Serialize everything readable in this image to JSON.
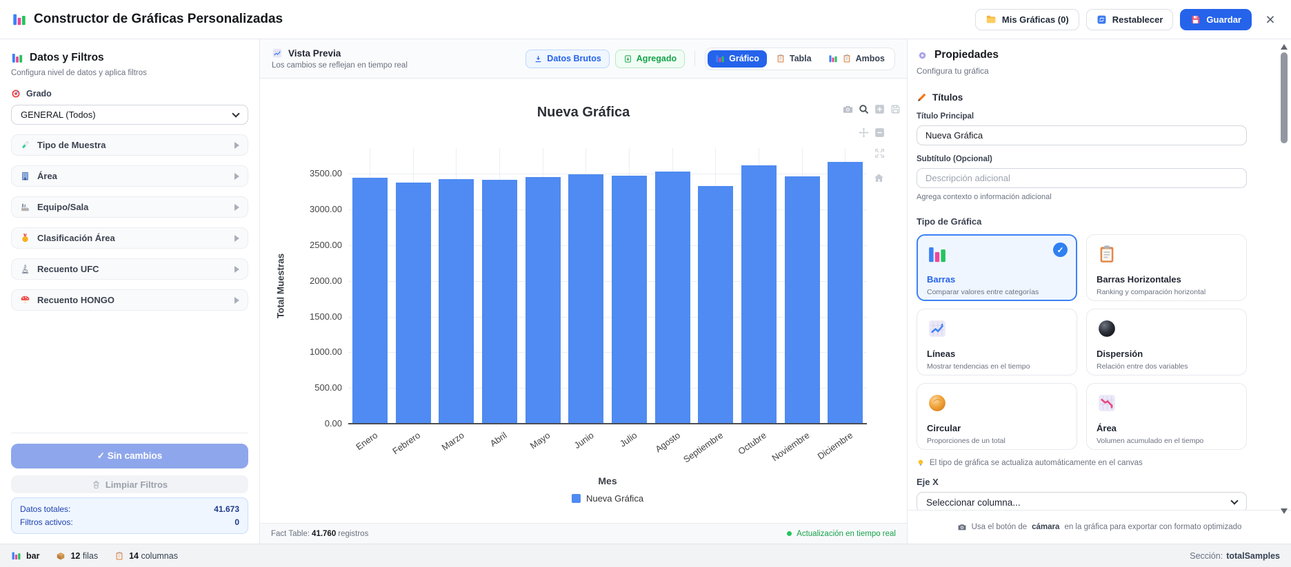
{
  "header": {
    "title": "Constructor de Gráficas Personalizadas",
    "my_charts_label": "Mis Gráficas (0)",
    "reset_label": "Restablecer",
    "save_label": "Guardar",
    "close_label": "×"
  },
  "sidebar": {
    "title": "Datos y Filtros",
    "subtitle": "Configura nivel de datos y aplica filtros",
    "grade_label": "Grado",
    "grade_value": "GENERAL (Todos)",
    "filters": [
      {
        "label": "Tipo de Muestra",
        "icon": "test-tube"
      },
      {
        "label": "Área",
        "icon": "office-building"
      },
      {
        "label": "Equipo/Sala",
        "icon": "factory"
      },
      {
        "label": "Clasificación Área",
        "icon": "medal"
      },
      {
        "label": "Recuento UFC",
        "icon": "microscope"
      },
      {
        "label": "Recuento HONGO",
        "icon": "mushroom"
      }
    ],
    "no_changes_label": "✓ Sin cambios",
    "clear_filters_label": "Limpiar Filtros",
    "totals": {
      "total_label": "Datos totales:",
      "total_value": "41.673",
      "active_label": "Filtros activos:",
      "active_value": "0"
    }
  },
  "preview": {
    "title": "Vista Previa",
    "subtitle": "Los cambios se reflejan en tiempo real",
    "raw_button": "Datos Brutos",
    "aggregated_button": "Agregado",
    "view_tabs": [
      {
        "label": "Gráfico",
        "icons": [
          "bar-chart"
        ],
        "active": true
      },
      {
        "label": "Tabla",
        "icons": [
          "clipboard"
        ],
        "active": false
      },
      {
        "label": "Ambos",
        "icons": [
          "bar-chart",
          "clipboard"
        ],
        "active": false
      }
    ],
    "fact_label": "Fact Table:",
    "fact_value": "41.760",
    "fact_suffix": "registros",
    "realtime_label": "Actualización en tiempo real"
  },
  "chart_data": {
    "type": "bar",
    "title": "Nueva Gráfica",
    "categories": [
      "Enero",
      "Febrero",
      "Marzo",
      "Abril",
      "Mayo",
      "Junio",
      "Julio",
      "Agosto",
      "Septiembre",
      "Octubre",
      "Noviembre",
      "Diciembre"
    ],
    "values": [
      3450,
      3378,
      3422,
      3415,
      3452,
      3490,
      3472,
      3528,
      3327,
      3624,
      3462,
      3664
    ],
    "xlabel": "Mes",
    "ylabel": "Total Muestras",
    "legend": [
      "Nueva Gráfica"
    ],
    "ylim": [
      0,
      3860
    ],
    "yticks": [
      0,
      500,
      1000,
      1500,
      2000,
      2500,
      3000,
      3500
    ],
    "bar_color": "#4f8bf2",
    "grid": true,
    "legend_position": "bottom"
  },
  "properties": {
    "title": "Propiedades",
    "subtitle": "Configura tu gráfica",
    "titles_section": "Títulos",
    "main_title_label": "Título Principal",
    "main_title_value": "Nueva Gráfica",
    "subtitle_label": "Subtítulo (Opcional)",
    "subtitle_placeholder": "Descripción adicional",
    "subtitle_help": "Agrega contexto o información adicional",
    "chart_type_label": "Tipo de Gráfica",
    "chart_types": [
      {
        "name": "Barras",
        "desc": "Comparar valores entre categorías",
        "icon": "bar-chart",
        "selected": true
      },
      {
        "name": "Barras Horizontales",
        "desc": "Ranking y comparación horizontal",
        "icon": "clipboard",
        "selected": false
      },
      {
        "name": "Líneas",
        "desc": "Mostrar tendencias en el tiempo",
        "icon": "line-chart",
        "selected": false
      },
      {
        "name": "Dispersión",
        "desc": "Relación entre dos variables",
        "icon": "sphere",
        "selected": false
      },
      {
        "name": "Circular",
        "desc": "Proporciones de un total",
        "icon": "orange-ball",
        "selected": false
      },
      {
        "name": "Área",
        "desc": "Volumen acumulado en el tiempo",
        "icon": "area-chart",
        "selected": false
      }
    ],
    "hint": "El tipo de gráfica se actualiza automáticamente en el canvas",
    "x_axis_label": "Eje X",
    "x_axis_placeholder": "Seleccionar columna...",
    "camera_note_prefix": "Usa el botón de",
    "camera_note_bold": "cámara",
    "camera_note_suffix": "en la gráfica para exportar con formato optimizado"
  },
  "statusbar": {
    "chart_type": "bar",
    "rows_value": "12",
    "rows_label": "filas",
    "cols_value": "14",
    "cols_label": "columnas",
    "section_label": "Sección:",
    "section_value": "totalSamples"
  }
}
